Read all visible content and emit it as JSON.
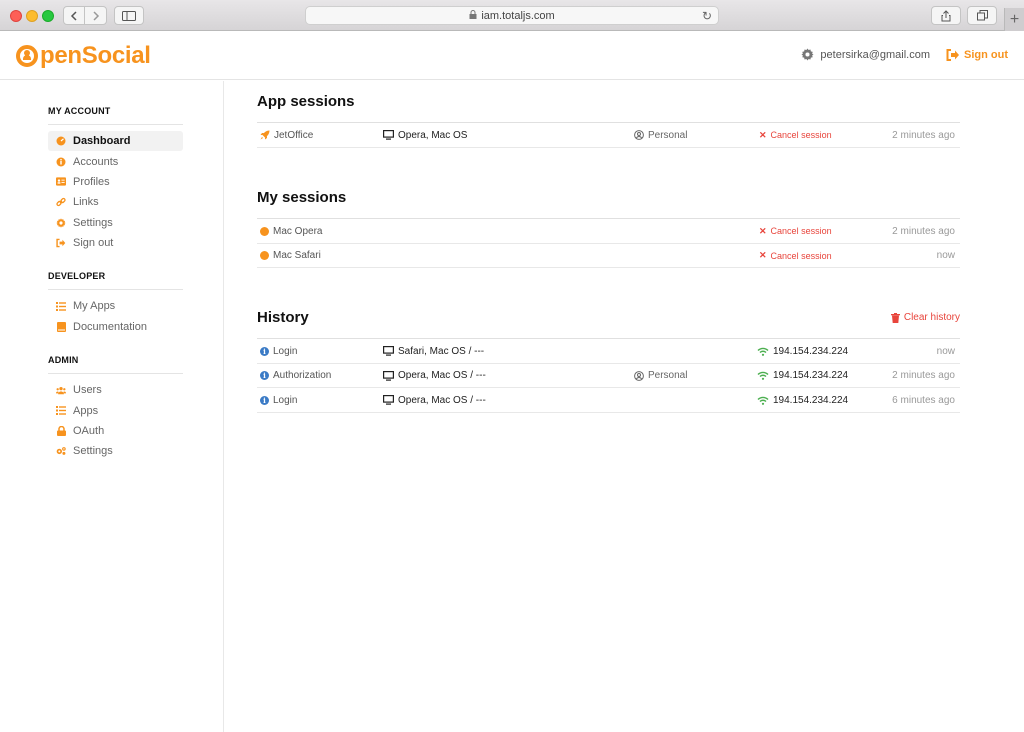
{
  "browser": {
    "url": "iam.totaljs.com",
    "back_icon": "chevron-left",
    "forward_icon": "chevron-right",
    "reload_icon": "reload",
    "new_tab": "+"
  },
  "header": {
    "logo": "penSocial",
    "user_email": "petersirka@gmail.com",
    "signout_label": "Sign out"
  },
  "sidebar": {
    "sections": [
      {
        "title": "MY ACCOUNT",
        "items": [
          {
            "label": "Dashboard",
            "icon": "dashboard-icon",
            "active": true
          },
          {
            "label": "Accounts",
            "icon": "info-icon"
          },
          {
            "label": "Profiles",
            "icon": "id-card-icon"
          },
          {
            "label": "Links",
            "icon": "link-icon"
          },
          {
            "label": "Settings",
            "icon": "gear-icon"
          },
          {
            "label": "Sign out",
            "icon": "sign-out-icon"
          }
        ]
      },
      {
        "title": "DEVELOPER",
        "items": [
          {
            "label": "My Apps",
            "icon": "list-icon"
          },
          {
            "label": "Documentation",
            "icon": "book-icon"
          }
        ]
      },
      {
        "title": "ADMIN",
        "items": [
          {
            "label": "Users",
            "icon": "users-icon"
          },
          {
            "label": "Apps",
            "icon": "list-icon"
          },
          {
            "label": "OAuth",
            "icon": "lock-icon"
          },
          {
            "label": "Settings",
            "icon": "gears-icon"
          }
        ]
      }
    ]
  },
  "app_sessions": {
    "title": "App sessions",
    "rows": [
      {
        "name": "JetOffice",
        "device": "Opera, Mac OS",
        "account": "Personal",
        "action": "Cancel session",
        "time": "2 minutes ago"
      }
    ]
  },
  "my_sessions": {
    "title": "My sessions",
    "rows": [
      {
        "name": "Mac Opera",
        "action": "Cancel session",
        "time": "2 minutes ago"
      },
      {
        "name": "Mac Safari",
        "action": "Cancel session",
        "time": "now"
      }
    ]
  },
  "history": {
    "title": "History",
    "clear_label": "Clear history",
    "rows": [
      {
        "type": "Login",
        "device": "Safari, Mac OS / ---",
        "account": "",
        "ip": "194.154.234.224",
        "time": "now"
      },
      {
        "type": "Authorization",
        "device": "Opera, Mac OS / ---",
        "account": "Personal",
        "ip": "194.154.234.224",
        "time": "2 minutes ago"
      },
      {
        "type": "Login",
        "device": "Opera, Mac OS / ---",
        "account": "",
        "ip": "194.154.234.224",
        "time": "6 minutes ago"
      }
    ]
  },
  "colors": {
    "brand": "#f7931e",
    "danger": "#e8453c",
    "info": "#3b7bc6",
    "signal": "#4caf50"
  }
}
